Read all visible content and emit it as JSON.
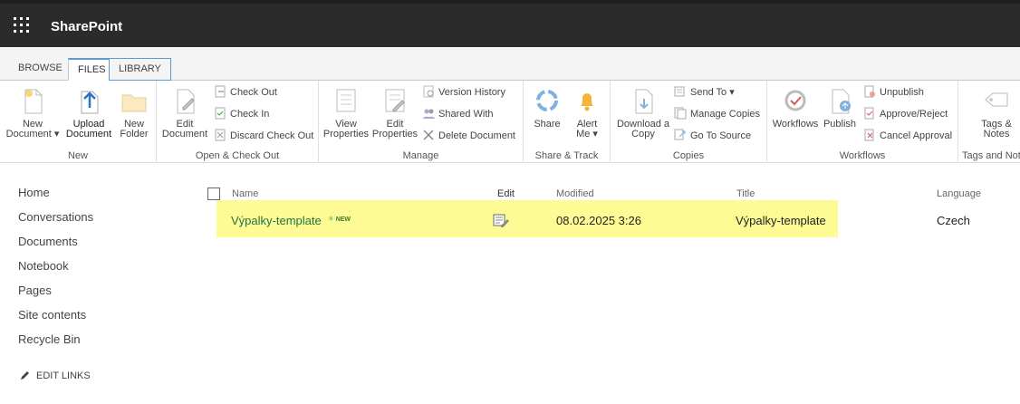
{
  "suite": {
    "app_name": "SharePoint"
  },
  "ribbon": {
    "tabs": [
      {
        "label": "BROWSE"
      },
      {
        "label": "FILES"
      },
      {
        "label": "LIBRARY"
      }
    ],
    "groups": {
      "new": {
        "label": "New",
        "new_document": "New\nDocument ▾",
        "upload_document": "Upload\nDocument",
        "new_folder": "New\nFolder"
      },
      "open_checkout": {
        "label": "Open & Check Out",
        "edit_document": "Edit\nDocument",
        "check_out": "Check Out",
        "check_in": "Check In",
        "discard_check_out": "Discard Check Out"
      },
      "manage": {
        "label": "Manage",
        "view_properties": "View\nProperties",
        "edit_properties": "Edit\nProperties",
        "version_history": "Version History",
        "shared_with": "Shared With",
        "delete_document": "Delete Document"
      },
      "share_track": {
        "label": "Share & Track",
        "share": "Share",
        "alert_me": "Alert\nMe ▾"
      },
      "copies": {
        "label": "Copies",
        "download_copy": "Download a\nCopy",
        "send_to": "Send To ▾",
        "manage_copies": "Manage Copies",
        "go_to_source": "Go To Source"
      },
      "workflows": {
        "label": "Workflows",
        "workflows": "Workflows",
        "publish": "Publish",
        "unpublish": "Unpublish",
        "approve_reject": "Approve/Reject",
        "cancel_approval": "Cancel Approval"
      },
      "tags_notes": {
        "label": "Tags and Note",
        "tags_notes": "Tags &\nNotes"
      }
    }
  },
  "nav": {
    "items": [
      "Home",
      "Conversations",
      "Documents",
      "Notebook",
      "Pages",
      "Site contents",
      "Recycle Bin"
    ],
    "edit_links": "EDIT LINKS"
  },
  "list": {
    "columns": {
      "name": "Name",
      "edit": "Edit",
      "modified": "Modified",
      "title": "Title",
      "language": "Language"
    },
    "rows": [
      {
        "name": "Výpalky-template",
        "badge": "NEW",
        "modified": "08.02.2025 3:26",
        "title": "Výpalky-template",
        "language": "Czech"
      }
    ]
  },
  "colors": {
    "suite_bar": "#2b2b2b",
    "accent": "#5a9bd5",
    "row_highlight": "#fffb94",
    "file_link": "#217346"
  }
}
